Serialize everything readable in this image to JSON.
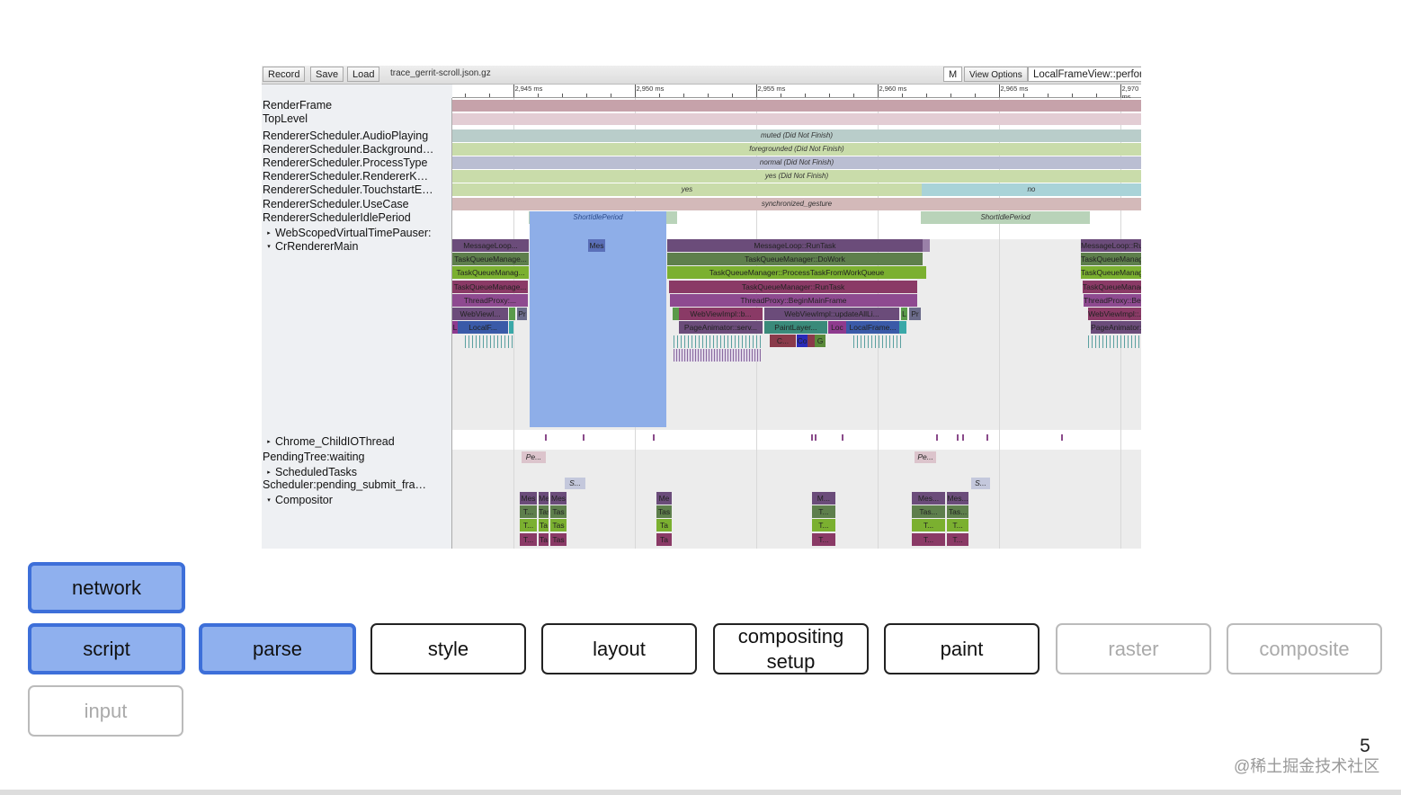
{
  "toolbar": {
    "record": "Record",
    "save": "Save",
    "load": "Load",
    "file": "trace_gerrit-scroll.json.gz",
    "m": "M",
    "view_options": "View Options",
    "search_value": "LocalFrameView::perform"
  },
  "chart_data": {
    "type": "flame",
    "x_range_ms": [
      2942.5,
      2970.87
    ],
    "ruler_ticks": [
      {
        "ms": 2945,
        "label": "2,945 ms"
      },
      {
        "ms": 2950,
        "label": "2,950 ms"
      },
      {
        "ms": 2955,
        "label": "2,955 ms"
      },
      {
        "ms": 2960,
        "label": "2,960 ms"
      },
      {
        "ms": 2965,
        "label": "2,965 ms"
      },
      {
        "ms": 2970,
        "label": "2,970 ms"
      }
    ],
    "tracks": [
      {
        "label": "RenderFrame",
        "expander": ""
      },
      {
        "label": "TopLevel",
        "expander": ""
      },
      {
        "label": "RendererScheduler.AudioPlaying",
        "expander": ""
      },
      {
        "label": "RendererScheduler.Background…",
        "expander": ""
      },
      {
        "label": "RendererScheduler.ProcessType",
        "expander": ""
      },
      {
        "label": "RendererScheduler.RendererK…",
        "expander": ""
      },
      {
        "label": "RendererScheduler.TouchstartE…",
        "expander": ""
      },
      {
        "label": "RendererScheduler.UseCase",
        "expander": ""
      },
      {
        "label": "RendererSchedulerIdlePeriod",
        "expander": ""
      },
      {
        "label": "WebScopedVirtualTimePauser:",
        "expander": "▸"
      },
      {
        "label": "CrRendererMain",
        "expander": "▾"
      },
      {
        "label": "Chrome_ChildIOThread",
        "expander": "▸"
      },
      {
        "label": "PendingTree:waiting",
        "expander": ""
      },
      {
        "label": "ScheduledTasks",
        "expander": "▸"
      },
      {
        "label": "Scheduler:pending_submit_fra…",
        "expander": ""
      },
      {
        "label": "Compositor",
        "expander": "▾"
      }
    ],
    "state_bands": [
      {
        "track": "RendererScheduler.AudioPlaying",
        "segments": [
          {
            "start": 2942.5,
            "end": 2970.87,
            "label": "muted (Did Not Finish)",
            "color": "#b9cdca"
          }
        ]
      },
      {
        "track": "RendererScheduler.Background",
        "segments": [
          {
            "start": 2942.5,
            "end": 2970.87,
            "label": "foregrounded (Did Not Finish)",
            "color": "#c9dcaa"
          }
        ]
      },
      {
        "track": "RendererScheduler.ProcessType",
        "segments": [
          {
            "start": 2942.5,
            "end": 2970.87,
            "label": "normal (Did Not Finish)",
            "color": "#babed2"
          }
        ]
      },
      {
        "track": "RendererScheduler.RendererK",
        "segments": [
          {
            "start": 2942.5,
            "end": 2970.87,
            "label": "yes (Did Not Finish)",
            "color": "#c9dcaa"
          }
        ]
      },
      {
        "track": "RendererScheduler.TouchstartE",
        "segments": [
          {
            "start": 2942.5,
            "end": 2961.83,
            "label": "yes",
            "color": "#c9dcaa"
          },
          {
            "start": 2961.83,
            "end": 2970.87,
            "label": "no",
            "color": "#a9d3d8"
          }
        ]
      },
      {
        "track": "RendererScheduler.UseCase",
        "segments": [
          {
            "start": 2942.5,
            "end": 2970.87,
            "label": "synchronized_gesture",
            "color": "#d3b9b9"
          }
        ]
      },
      {
        "track": "RendererSchedulerIdlePeriod",
        "segments": [
          {
            "start": 2945.65,
            "end": 2951.76,
            "label": "ShortIdlePeriod",
            "color": "#b9d3b9"
          },
          {
            "start": 2961.8,
            "end": 2968.76,
            "label": "ShortIdlePeriod",
            "color": "#b9d3b9"
          }
        ]
      }
    ],
    "main_slices": [
      {
        "row": 0,
        "start": 2942.5,
        "end": 2945.65,
        "label": "MessageLoop...",
        "color": "#6b4c7a"
      },
      {
        "row": 0,
        "start": 2948.09,
        "end": 2948.8,
        "label": "Mes",
        "color": "#5a6fb8"
      },
      {
        "row": 0,
        "start": 2951.35,
        "end": 2961.87,
        "label": "MessageLoop::RunTask",
        "color": "#6b4c7a"
      },
      {
        "row": 0,
        "start": 2961.87,
        "end": 2962.17,
        "label": "",
        "color": "#9a80a8"
      },
      {
        "row": 0,
        "start": 2968.39,
        "end": 2970.87,
        "label": "MessageLoop::RunTask",
        "color": "#6b4c7a"
      },
      {
        "row": 1,
        "start": 2942.5,
        "end": 2945.65,
        "label": "TaskQueueManage...",
        "color": "#5e7f4c"
      },
      {
        "row": 1,
        "start": 2951.35,
        "end": 2961.87,
        "label": "TaskQueueManager::DoWork",
        "color": "#5e7f4c"
      },
      {
        "row": 1,
        "start": 2968.39,
        "end": 2970.87,
        "label": "TaskQueueManager::DoWork",
        "color": "#5e7f4c"
      },
      {
        "row": 2,
        "start": 2942.5,
        "end": 2945.65,
        "label": "TaskQueueManag...",
        "color": "#7bb030"
      },
      {
        "row": 2,
        "start": 2951.35,
        "end": 2962.02,
        "label": "TaskQueueManager::ProcessTaskFromWorkQueue",
        "color": "#7bb030"
      },
      {
        "row": 2,
        "start": 2968.39,
        "end": 2970.87,
        "label": "TaskQueueManager::ProcessTaskFromWorkQueue",
        "color": "#7bb030"
      },
      {
        "row": 3,
        "start": 2942.5,
        "end": 2945.61,
        "label": "TaskQueueManage...",
        "color": "#8a3a66"
      },
      {
        "row": 3,
        "start": 2951.43,
        "end": 2961.65,
        "label": "TaskQueueManager::RunTask",
        "color": "#8a3a66"
      },
      {
        "row": 3,
        "start": 2968.46,
        "end": 2970.87,
        "label": "TaskQueueManager::RunTask",
        "color": "#8a3a66"
      },
      {
        "row": 4,
        "start": 2942.5,
        "end": 2945.61,
        "label": "ThreadProxy:...",
        "color": "#8e4a90"
      },
      {
        "row": 4,
        "start": 2951.46,
        "end": 2961.65,
        "label": "ThreadProxy::BeginMainFrame",
        "color": "#8e4a90"
      },
      {
        "row": 4,
        "start": 2968.5,
        "end": 2970.87,
        "label": "ThreadProxy::BeginMainFrame",
        "color": "#8e4a90"
      },
      {
        "row": 5,
        "start": 2942.5,
        "end": 2944.8,
        "label": "WebViewI...",
        "color": "#6b4c7a"
      },
      {
        "row": 5,
        "start": 2944.83,
        "end": 2945.09,
        "label": "",
        "color": "#5a9a4a"
      },
      {
        "row": 5,
        "start": 2945.17,
        "end": 2945.57,
        "label": "Pr",
        "color": "#6b6b8a"
      },
      {
        "row": 5,
        "start": 2951.57,
        "end": 2951.83,
        "label": "",
        "color": "#5a9a4a"
      },
      {
        "row": 5,
        "start": 2951.83,
        "end": 2955.28,
        "label": "WebViewImpl::b...",
        "color": "#8a3a66"
      },
      {
        "row": 5,
        "start": 2955.35,
        "end": 2960.91,
        "label": "WebViewImpl::updateAllLi...",
        "color": "#6b4c7a"
      },
      {
        "row": 5,
        "start": 2960.98,
        "end": 2961.24,
        "label": "L",
        "color": "#5a9a4a"
      },
      {
        "row": 5,
        "start": 2961.31,
        "end": 2961.8,
        "label": "Pr",
        "color": "#6b6b8a"
      },
      {
        "row": 5,
        "start": 2968.69,
        "end": 2970.87,
        "label": "WebViewImpl::...",
        "color": "#8a3a66"
      },
      {
        "row": 6,
        "start": 2942.5,
        "end": 2942.72,
        "label": "L",
        "color": "#8e3a8e"
      },
      {
        "row": 6,
        "start": 2942.72,
        "end": 2944.8,
        "label": "LocalF...",
        "color": "#3a5aa8"
      },
      {
        "row": 6,
        "start": 2944.83,
        "end": 2945.02,
        "label": "",
        "color": "#3aa8a8"
      },
      {
        "row": 6,
        "start": 2951.83,
        "end": 2955.28,
        "label": "PageAnimator::serv...",
        "color": "#6b4c7a"
      },
      {
        "row": 6,
        "start": 2955.35,
        "end": 2957.94,
        "label": "PaintLayer...",
        "color": "#3a8a7a"
      },
      {
        "row": 6,
        "start": 2957.98,
        "end": 2958.72,
        "label": "Loc",
        "color": "#8e3a8e"
      },
      {
        "row": 6,
        "start": 2958.72,
        "end": 2960.91,
        "label": "LocalFrame...",
        "color": "#3a5aa8"
      },
      {
        "row": 6,
        "start": 2960.91,
        "end": 2961.2,
        "label": "",
        "color": "#3aa8a8"
      },
      {
        "row": 6,
        "start": 2968.8,
        "end": 2970.87,
        "label": "PageAnimator::...",
        "color": "#6b4c7a"
      },
      {
        "row": 7,
        "start": 2955.57,
        "end": 2956.65,
        "label": "C...",
        "color": "#8a3a4a"
      },
      {
        "row": 7,
        "start": 2956.69,
        "end": 2957.13,
        "label": "Co",
        "color": "#2a2ab8"
      },
      {
        "row": 7,
        "start": 2957.13,
        "end": 2957.43,
        "label": "",
        "color": "#8a3a4a"
      },
      {
        "row": 7,
        "start": 2957.43,
        "end": 2957.87,
        "label": "G",
        "color": "#5a8a3a"
      }
    ],
    "idle_overlay": {
      "start": 2945.69,
      "end": 2951.31,
      "label": "ShortIdlePeriod",
      "color": "#8eaee8"
    },
    "io_ticks": [
      2946.31,
      2947.87,
      2950.76,
      2957.28,
      2957.43,
      2958.54,
      2962.43,
      2963.28,
      2963.5,
      2964.5,
      2967.57
    ],
    "pending_slices": [
      {
        "row": 0,
        "start": 2945.35,
        "end": 2946.35,
        "label": "Pe...",
        "color": "#dcc4cc"
      },
      {
        "row": 0,
        "start": 2961.54,
        "end": 2962.43,
        "label": "Pe...",
        "color": "#dcc4cc"
      },
      {
        "row": 2,
        "start": 2947.13,
        "end": 2947.98,
        "label": "S...",
        "color": "#c4c8dc"
      },
      {
        "row": 2,
        "start": 2963.87,
        "end": 2964.65,
        "label": "S...",
        "color": "#c4c8dc"
      }
    ],
    "compositor_groups": [
      {
        "start": 2945.28,
        "end": 2946.02,
        "labels": [
          "Mes",
          "T...",
          "T...",
          "T..."
        ]
      },
      {
        "start": 2946.06,
        "end": 2946.5,
        "labels": [
          "Me",
          "Tas",
          "Ta",
          "Ta"
        ]
      },
      {
        "start": 2946.54,
        "end": 2947.24,
        "labels": [
          "Mes",
          "Tas",
          "Tas",
          "Tas"
        ]
      },
      {
        "start": 2950.91,
        "end": 2951.57,
        "labels": [
          "Me",
          "Tas",
          "Ta",
          "Ta"
        ]
      },
      {
        "start": 2957.31,
        "end": 2958.31,
        "labels": [
          "M...",
          "T...",
          "T...",
          "T..."
        ]
      },
      {
        "start": 2961.43,
        "end": 2962.83,
        "labels": [
          "Mes...",
          "Tas...",
          "T...",
          "T..."
        ]
      },
      {
        "start": 2962.87,
        "end": 2963.8,
        "labels": [
          "Mes...",
          "Tas...",
          "T...",
          "T..."
        ]
      }
    ],
    "compositor_colors": [
      "#6b4c7a",
      "#5e7f4c",
      "#7bb030",
      "#8a3a66"
    ]
  },
  "buttons": [
    {
      "label": "network",
      "state": "on"
    },
    {
      "label": "script",
      "state": "on"
    },
    {
      "label": "parse",
      "state": "on"
    },
    {
      "label": "style",
      "state": "normal"
    },
    {
      "label": "layout",
      "state": "normal"
    },
    {
      "label": "compositing setup",
      "state": "normal"
    },
    {
      "label": "paint",
      "state": "normal"
    },
    {
      "label": "raster",
      "state": "off"
    },
    {
      "label": "composite",
      "state": "off"
    },
    {
      "label": "input",
      "state": "off"
    }
  ],
  "slide_number": "5",
  "watermark": "@稀土掘金技术社区"
}
